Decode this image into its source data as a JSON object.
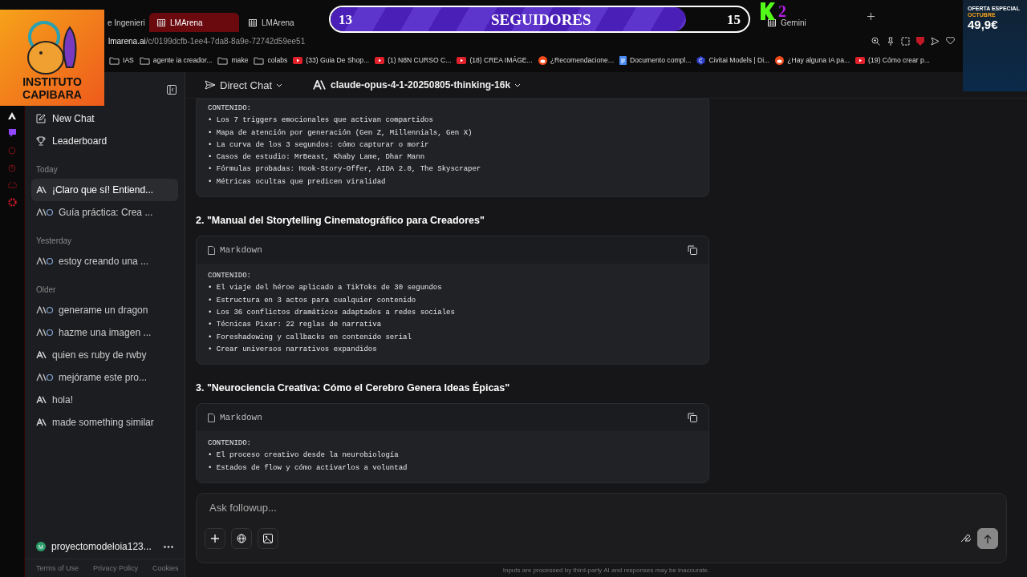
{
  "overlay": {
    "logo_lines": [
      "INSTITUTO",
      "CAPIBARA"
    ],
    "followers": {
      "current": "13",
      "label": "SEGUIDORES",
      "goal": "15",
      "level": 0.85
    },
    "badge": "2",
    "ad": {
      "kicker": "OFERTA ESPECIAL",
      "month": "OCTUBRE",
      "price": "49,9€"
    }
  },
  "browser": {
    "tabs": [
      {
        "label": "e Ingenieri",
        "selected": false
      },
      {
        "label": "LMArena",
        "selected": true
      },
      {
        "label": "LMArena",
        "selected": false
      },
      {
        "label": "Gemini",
        "selected": false
      }
    ],
    "url": {
      "domain": "lmarena.ai",
      "path": "/c/0199dcfb-1ee4-7da8-8a9e-72742d59ee51"
    },
    "bookmarks": [
      {
        "kind": "folder",
        "label": "IAS"
      },
      {
        "kind": "folder",
        "label": "agente ia creador..."
      },
      {
        "kind": "folder",
        "label": "make"
      },
      {
        "kind": "folder",
        "label": "colabs"
      },
      {
        "kind": "video",
        "label": "(33) Guia De Shop..."
      },
      {
        "kind": "video",
        "label": "(1) N8N CURSO C..."
      },
      {
        "kind": "video",
        "label": "(18) CREA IMÁGE..."
      },
      {
        "kind": "forum",
        "label": "¿Recomendacione..."
      },
      {
        "kind": "doc",
        "label": "Documento compl..."
      },
      {
        "kind": "site",
        "label": "Civitai Models | Di..."
      },
      {
        "kind": "forum",
        "label": "¿Hay alguna IA pa..."
      },
      {
        "kind": "video",
        "label": "(19) Cómo crear p..."
      }
    ]
  },
  "sidebar": {
    "menu": [
      "New Chat",
      "Leaderboard"
    ],
    "sections": [
      {
        "title": "Today",
        "items": [
          {
            "label": "¡Claro que sí! Entiend...",
            "kind": "single",
            "selected": true
          },
          {
            "label": "Guía práctica: Crea ...",
            "kind": "pair",
            "selected": false
          }
        ]
      },
      {
        "title": "Yesterday",
        "items": [
          {
            "label": "estoy creando una ...",
            "kind": "pair",
            "selected": false
          }
        ]
      },
      {
        "title": "Older",
        "items": [
          {
            "label": "generame un dragon",
            "kind": "pair",
            "selected": false
          },
          {
            "label": "hazme una imagen ...",
            "kind": "pair",
            "selected": false
          },
          {
            "label": "quien es ruby de rwby",
            "kind": "single",
            "selected": false
          },
          {
            "label": "mejórame este pro...",
            "kind": "pair",
            "selected": false
          },
          {
            "label": "hola!",
            "kind": "single",
            "selected": false
          },
          {
            "label": "made something similar",
            "kind": "single",
            "selected": false
          }
        ]
      }
    ],
    "user": {
      "initial": "M",
      "name": "proyectomodeloia123..."
    },
    "footer_links": [
      "Terms of Use",
      "Privacy Policy",
      "Cookies"
    ]
  },
  "header": {
    "mode": "Direct Chat",
    "model": "claude-opus-4-1-20250805-thinking-16k"
  },
  "content": {
    "first_block": {
      "lines": [
        "CONTENIDO:",
        "• Los 7 triggers emocionales que activan compartidos",
        "• Mapa de atención por generación (Gen Z, Millennials, Gen X)",
        "• La curva de los 3 segundos: cómo capturar o morir",
        "• Casos de estudio: MrBeast, Khaby Lame, Dhar Mann",
        "• Fórmulas probadas: Hook-Story-Offer, AIDA 2.0, The Skyscraper",
        "• Métricas ocultas que predicen viralidad"
      ]
    },
    "sections": [
      {
        "heading": "2. \"Manual del Storytelling Cinematográfico para Creadores\"",
        "language": "Markdown",
        "lines": [
          "CONTENIDO:",
          "• El viaje del héroe aplicado a TikToks de 30 segundos",
          "• Estructura en 3 actos para cualquier contenido",
          "• Los 36 conflictos dramáticos adaptados a redes sociales",
          "• Técnicas Pixar: 22 reglas de narrativa",
          "• Foreshadowing y callbacks en contenido serial",
          "• Crear universos narrativos expandidos"
        ]
      },
      {
        "heading": "3. \"Neurociencia Creativa: Cómo el Cerebro Genera Ideas Épicas\"",
        "language": "Markdown",
        "lines": [
          "CONTENIDO:",
          "• El proceso creativo desde la neurobiología",
          "• Estados de flow y cómo activarlos a voluntad"
        ]
      }
    ]
  },
  "composer": {
    "placeholder": "Ask followup...",
    "disclaimer": "Inputs are processed by third-party AI and responses may be inaccurate."
  }
}
